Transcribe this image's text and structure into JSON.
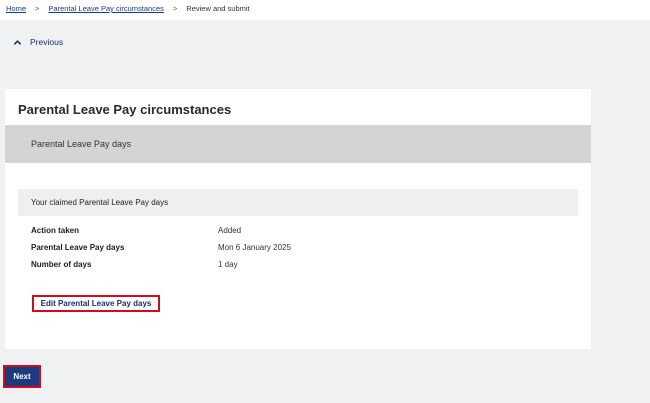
{
  "breadcrumb": {
    "items": [
      {
        "label": "Home"
      },
      {
        "label": "Parental Leave Pay circumstances"
      },
      {
        "label": "Review and submit"
      }
    ],
    "separator": ">"
  },
  "navigation": {
    "previous_label": "Previous",
    "previous_icon": "chevron-up-icon"
  },
  "card": {
    "title": "Parental Leave Pay circumstances",
    "section_label": "Parental Leave Pay days",
    "claimed_heading": "Your claimed Parental Leave Pay days",
    "details": [
      {
        "label": "Action taken",
        "value": "Added"
      },
      {
        "label": "Parental Leave Pay days",
        "value": "Mon 6 January 2025"
      },
      {
        "label": "Number of days",
        "value": "1 day"
      }
    ],
    "edit_button_label": "Edit Parental Leave Pay days"
  },
  "footer": {
    "next_label": "Next"
  },
  "colors": {
    "page_background": "#f0f1f3",
    "primary_button": "#1c3a7e",
    "highlight_outline": "#d10a1d",
    "section_band": "#d4d4d4",
    "link": "#1a3a8a"
  }
}
